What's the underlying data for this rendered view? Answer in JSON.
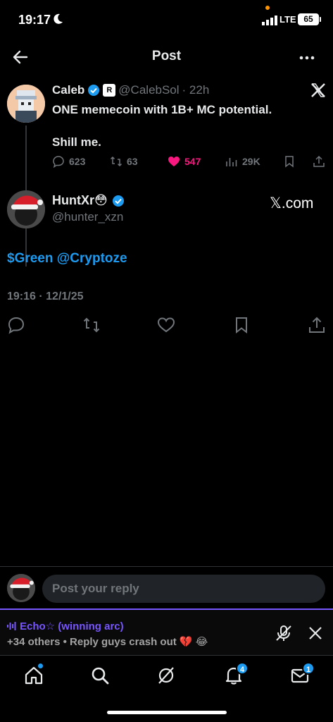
{
  "status_bar": {
    "time": "19:17",
    "network": "LTE",
    "battery": "65"
  },
  "nav": {
    "title": "Post"
  },
  "quoted_tweet": {
    "name": "Caleb",
    "handle": "@CalebSol",
    "time": "· 22h",
    "text_line1": "ONE memecoin with 1B+ MC potential.",
    "text_line2": "Shill me.",
    "replies": "623",
    "reposts": "63",
    "likes": "547",
    "views": "29K"
  },
  "main_tweet": {
    "name": "HuntXr😳",
    "handle": "@hunter_xzn",
    "source": "𝕏.com",
    "text": "$Green @Cryptoze",
    "timestamp": "19:16 · 12/1/25"
  },
  "reply": {
    "placeholder": "Post your reply"
  },
  "space": {
    "title": "Echo☆ (winning arc)",
    "subtitle": "+34 others • Reply guys crash out 💔 😂"
  },
  "tabs": {
    "notifications_badge": "4",
    "messages_badge": "1"
  },
  "colors": {
    "accent": "#1d9bf0",
    "like": "#f91880",
    "space": "#7856ff"
  }
}
